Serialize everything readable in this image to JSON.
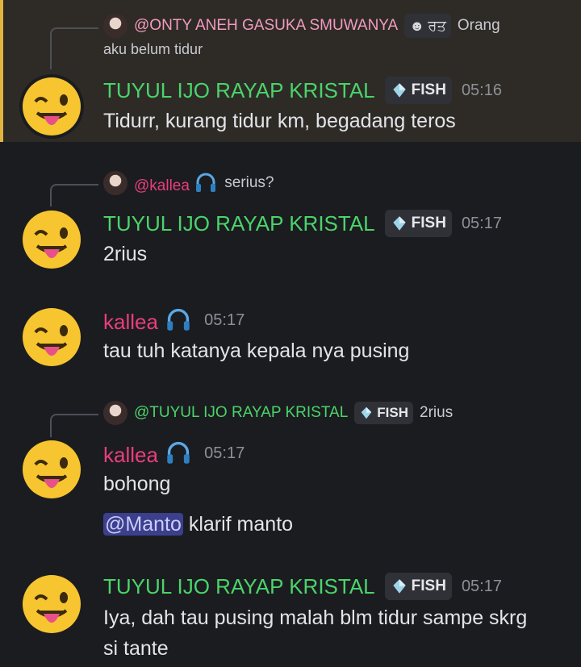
{
  "messages": [
    {
      "reply": {
        "name": "@ONTY ANEH GASUKA SMUWANYA",
        "tag": "ਰਤ",
        "text": "Orang",
        "text2": "aku belum tidur"
      },
      "author": "TUYUL IJO RAYAP KRISTAL",
      "tag": "FISH",
      "time": "05:16",
      "lines": [
        "Tidurr, kurang tidur km, begadang teros"
      ]
    },
    {
      "reply": {
        "name": "@kallea",
        "text": "serius?"
      },
      "author": "TUYUL IJO RAYAP KRISTAL",
      "tag": "FISH",
      "time": "05:17",
      "lines": [
        "2rius"
      ]
    },
    {
      "author": "kallea",
      "time": "05:17",
      "lines": [
        "tau tuh katanya kepala nya pusing"
      ]
    },
    {
      "reply": {
        "name": "@TUYUL IJO RAYAP KRISTAL",
        "tag": "FISH",
        "text": "2rius"
      },
      "author": "kallea",
      "time": "05:17",
      "lines": [
        "bohong"
      ],
      "mention": "@Manto",
      "mention_text": "klarif manto"
    },
    {
      "author": "TUYUL IJO RAYAP KRISTAL",
      "tag": "FISH",
      "time": "05:17",
      "lines": [
        "Iya, dah tau pusing malah blm tidur sampe skrg",
        "si tante"
      ]
    }
  ],
  "colors": {
    "role_green": "#4ad46a",
    "role_pink": "#e83f7b",
    "highlight_bar": "#e3b340"
  }
}
